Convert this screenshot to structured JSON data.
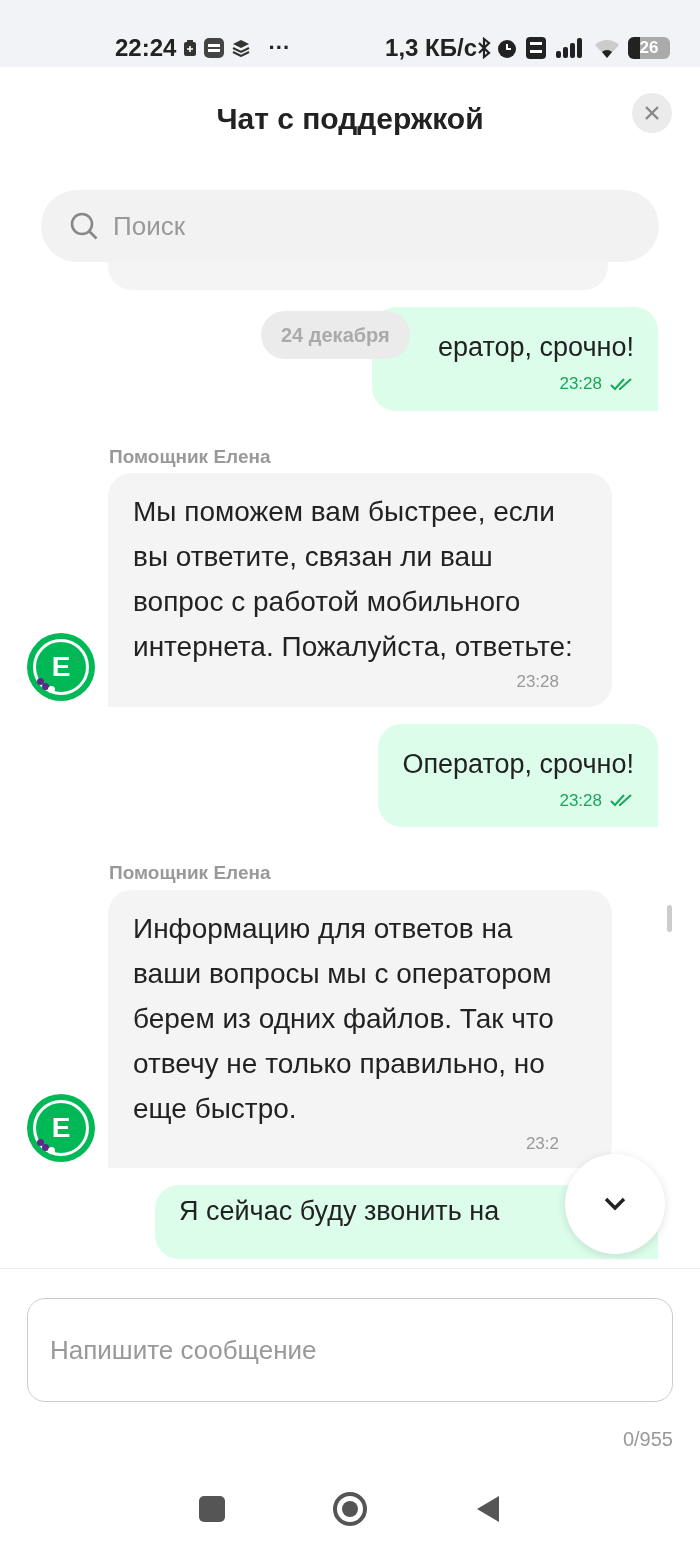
{
  "status_bar": {
    "time": "22:24",
    "speed": "1,3 КБ/с",
    "battery": "26",
    "more": "···"
  },
  "header": {
    "title": "Чат с поддержкой"
  },
  "search": {
    "placeholder": "Поиск"
  },
  "date_divider": "24 декабря",
  "messages": [
    {
      "kind": "outgoing",
      "text": "ератор, срочно!",
      "time": "23:28",
      "read": true
    },
    {
      "kind": "incoming",
      "sender": "Помощник Елена",
      "avatar_letter": "E",
      "text": "Мы поможем вам быстрее, если вы ответите, связан ли ваш вопрос с работой мобильного интернета. Пожалуйста, ответьте:",
      "time": "23:28"
    },
    {
      "kind": "outgoing",
      "text": "Оператор, срочно!",
      "time": "23:28",
      "read": true
    },
    {
      "kind": "incoming",
      "sender": "Помощник Елена",
      "avatar_letter": "E",
      "text": "Информацию для ответов на ваши вопросы мы с оператором берем из одних файлов. Так что отвечу не только правильно, но еще быстро.",
      "time": "23:2"
    },
    {
      "kind": "outgoing",
      "text": "Я сейчас буду звонить на"
    }
  ],
  "composer": {
    "placeholder": "Напишите сообщение",
    "counter": "0/955"
  }
}
